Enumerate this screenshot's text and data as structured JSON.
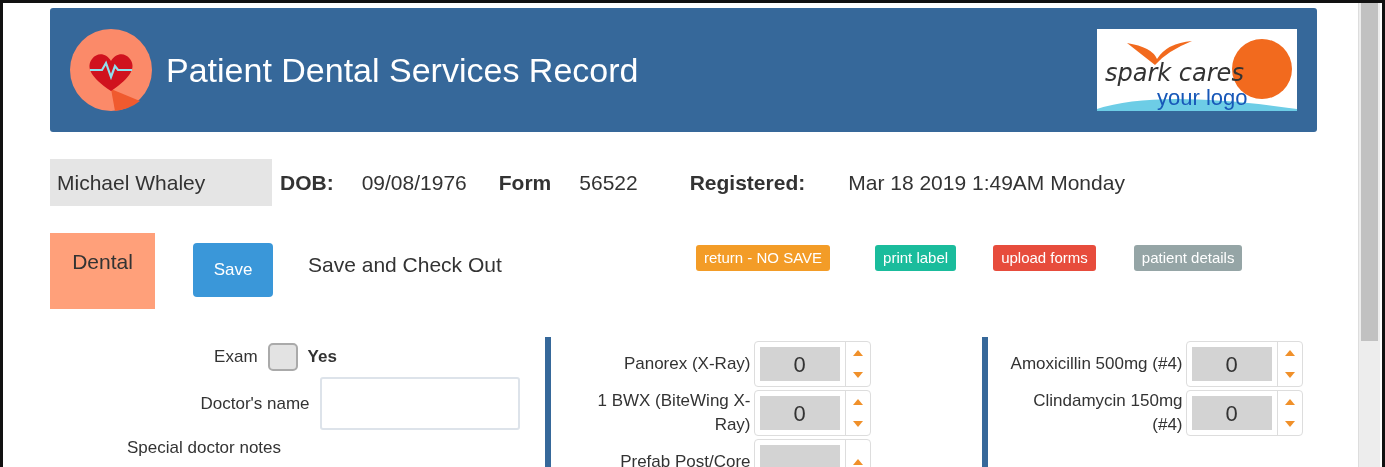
{
  "header": {
    "title": "Patient Dental Services Record",
    "logo": {
      "line_1": "spark cares",
      "line_2": "your logo"
    }
  },
  "patient": {
    "name": "Michael Whaley",
    "fields": [
      {
        "label": "DOB:",
        "value": "09/08/1976"
      },
      {
        "label": "Form",
        "value": "56522"
      },
      {
        "label": "Registered:",
        "value": "Mar 18 2019 1:49AM Monday"
      }
    ]
  },
  "actions": {
    "section": "Dental",
    "save": "Save",
    "save_checkout": "Save and Check Out",
    "badges": [
      {
        "label": "return - NO SAVE",
        "color": "#f39c27"
      },
      {
        "label": "print label",
        "color": "#1abc9c"
      },
      {
        "label": "upload forms",
        "color": "#e74c3c"
      },
      {
        "label": "patient details",
        "color": "#95a5a6"
      }
    ]
  },
  "exam": {
    "label": "Exam",
    "option": "Yes",
    "checked": false
  },
  "doctor_name": {
    "label": "Doctor's name"
  },
  "notes_label": "Special doctor notes",
  "xray_items": [
    {
      "label": "Panorex (X-Ray)",
      "value": "0"
    },
    {
      "label": "1 BWX (BiteWing X-Ray)",
      "value": "0"
    },
    {
      "label": "Prefab Post/Core"
    }
  ],
  "medication_items": [
    {
      "label": "Amoxicillin 500mg (#4)",
      "value": "0"
    },
    {
      "label": "Clindamycin 150mg (#4)",
      "value": "0"
    }
  ]
}
